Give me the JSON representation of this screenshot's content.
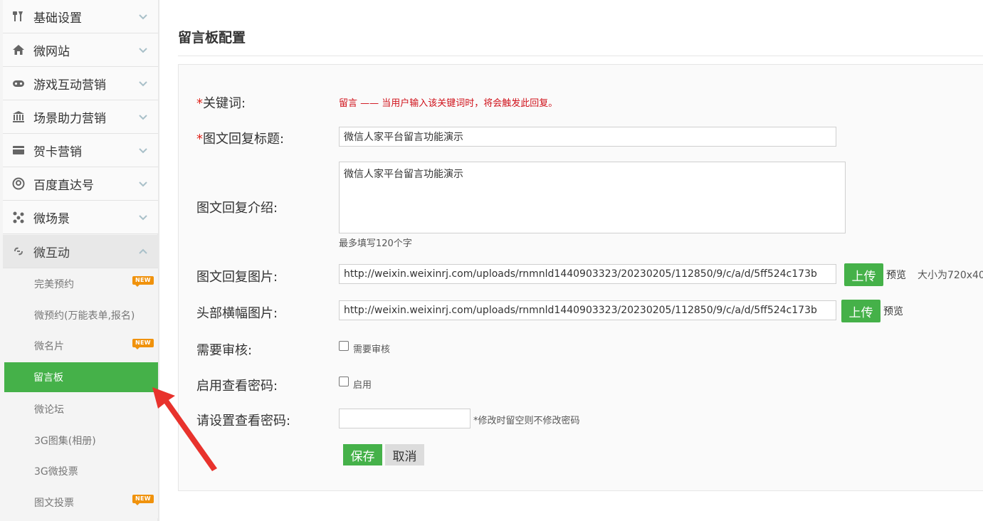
{
  "sidebar": {
    "menus": [
      {
        "label": "基础设置",
        "icon": "tools-icon"
      },
      {
        "label": "微网站",
        "icon": "home-icon"
      },
      {
        "label": "游戏互动营销",
        "icon": "gamepad-icon"
      },
      {
        "label": "场景助力营销",
        "icon": "bank-icon"
      },
      {
        "label": "贺卡营销",
        "icon": "card-icon"
      },
      {
        "label": "百度直达号",
        "icon": "target-icon"
      },
      {
        "label": "微场景",
        "icon": "molecule-icon"
      },
      {
        "label": "微互动",
        "icon": "interact-icon"
      }
    ],
    "submenu": [
      {
        "label": "完美预约",
        "badge": "NEW"
      },
      {
        "label": "微预约(万能表单,报名)",
        "badge": ""
      },
      {
        "label": "微名片",
        "badge": "NEW"
      },
      {
        "label": "留言板",
        "badge": ""
      },
      {
        "label": "微论坛",
        "badge": ""
      },
      {
        "label": "3G图集(相册)",
        "badge": ""
      },
      {
        "label": "3G微投票",
        "badge": ""
      },
      {
        "label": "图文投票",
        "badge": "NEW"
      }
    ]
  },
  "page": {
    "title": "留言板配置"
  },
  "form": {
    "required_mark": "*",
    "keyword_label": "关键词:",
    "keyword_hint": "留言 —— 当用户输入该关键词时，将会触发此回复。",
    "title_label": "图文回复标题:",
    "title_value": "微信人家平台留言功能演示",
    "intro_label": "图文回复介绍:",
    "intro_value": "微信人家平台留言功能演示",
    "intro_note": "最多填写120个字",
    "image_label": "图文回复图片:",
    "image_value": "http://weixin.weixinrj.com/uploads/rnmnld1440903323/20230205/112850/9/c/a/d/5ff524c173b",
    "image_upload": "上传",
    "image_preview": "预览",
    "image_size_note": "大小为720x40",
    "banner_label": "头部横幅图片:",
    "banner_value": "http://weixin.weixinrj.com/uploads/rnmnld1440903323/20230205/112850/9/c/a/d/5ff524c173b",
    "banner_upload": "上传",
    "banner_preview": "预览",
    "review_label": "需要审核:",
    "review_option": "需要审核",
    "password_enable_label": "启用查看密码:",
    "password_enable_option": "启用",
    "password_label": "请设置查看密码:",
    "password_value": "",
    "password_note": "*修改时留空则不修改密码",
    "save": "保存",
    "cancel": "取消"
  },
  "colors": {
    "accent": "#45b149",
    "required": "#e0241b",
    "badge": "#f0920c",
    "arrow": "#e8322c"
  }
}
